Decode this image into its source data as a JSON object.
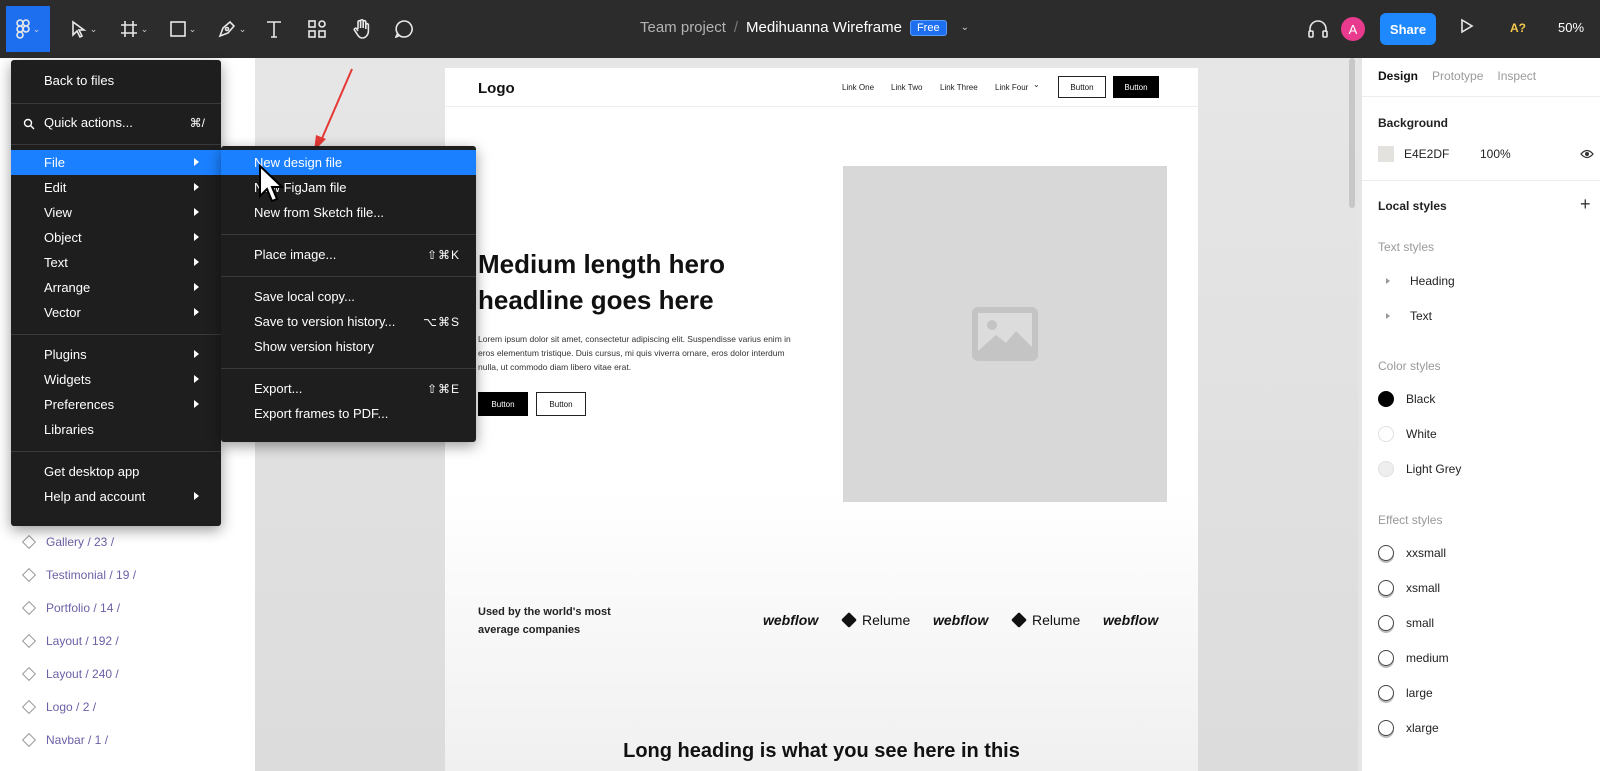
{
  "toolbar": {
    "team": "Team project",
    "separator": "/",
    "file_name": "Medihuanna Wireframe",
    "plan_badge": "Free",
    "avatar_letter": "A",
    "share_label": "Share",
    "badge": "A?",
    "zoom": "50%"
  },
  "main_menu": {
    "back": "Back to files",
    "quick_actions": "Quick actions...",
    "quick_actions_shortcut": "⌘/",
    "items": [
      "File",
      "Edit",
      "View",
      "Object",
      "Text",
      "Arrange",
      "Vector"
    ],
    "items2": [
      "Plugins",
      "Widgets",
      "Preferences",
      "Libraries"
    ],
    "items3": [
      "Get desktop app",
      "Help and account"
    ]
  },
  "file_menu": {
    "new_design": "New design file",
    "new_figjam": "New FigJam file",
    "new_sketch": "New from Sketch file...",
    "place_image": "Place image...",
    "place_image_shortcut": "⇧⌘K",
    "save_local": "Save local copy...",
    "save_version": "Save to version history...",
    "save_version_shortcut": "⌥⌘S",
    "show_version": "Show version history",
    "export": "Export...",
    "export_shortcut": "⇧⌘E",
    "export_pdf": "Export frames to PDF..."
  },
  "layers": [
    "Gallery / 23 /",
    "Testimonial / 19 /",
    "Portfolio / 14 /",
    "Layout / 192 /",
    "Layout / 240 /",
    "Logo / 2 /",
    "Navbar / 1 /"
  ],
  "frame": {
    "logo": "Logo",
    "nav": [
      "Link One",
      "Link Two",
      "Link Three",
      "Link Four"
    ],
    "nav_chevron": "⌄",
    "button": "Button",
    "headline": "Medium length hero headline goes here",
    "body": "Lorem ipsum dolor sit amet, consectetur adipiscing elit. Suspendisse varius enim in eros elementum tristique. Duis cursus, mi quis viverra ornare, eros dolor interdum nulla, ut commodo diam libero vitae erat.",
    "used_by": "Used by the world's most average companies",
    "brands": [
      "webflow",
      "Relume",
      "webflow",
      "Relume",
      "webflow"
    ],
    "long_heading": "Long heading is what you see here in this"
  },
  "right_panel": {
    "tabs": [
      "Design",
      "Prototype",
      "Inspect"
    ],
    "background_title": "Background",
    "bg_hex": "E4E2DF",
    "bg_opacity": "100%",
    "local_styles": "Local styles",
    "text_styles": "Text styles",
    "text_style_items": [
      "Heading",
      "Text"
    ],
    "color_styles": "Color styles",
    "color_items": [
      {
        "name": "Black",
        "color": "#000000"
      },
      {
        "name": "White",
        "color": "#ffffff"
      },
      {
        "name": "Light Grey",
        "color": "#eeeeee"
      }
    ],
    "effect_styles": "Effect styles",
    "effect_items": [
      "xxsmall",
      "xsmall",
      "small",
      "medium",
      "large",
      "xlarge"
    ]
  },
  "colors": {
    "accent": "#1b80ff",
    "toolbar_bg": "#2c2c2c",
    "menu_bg": "#1e1e1e"
  }
}
